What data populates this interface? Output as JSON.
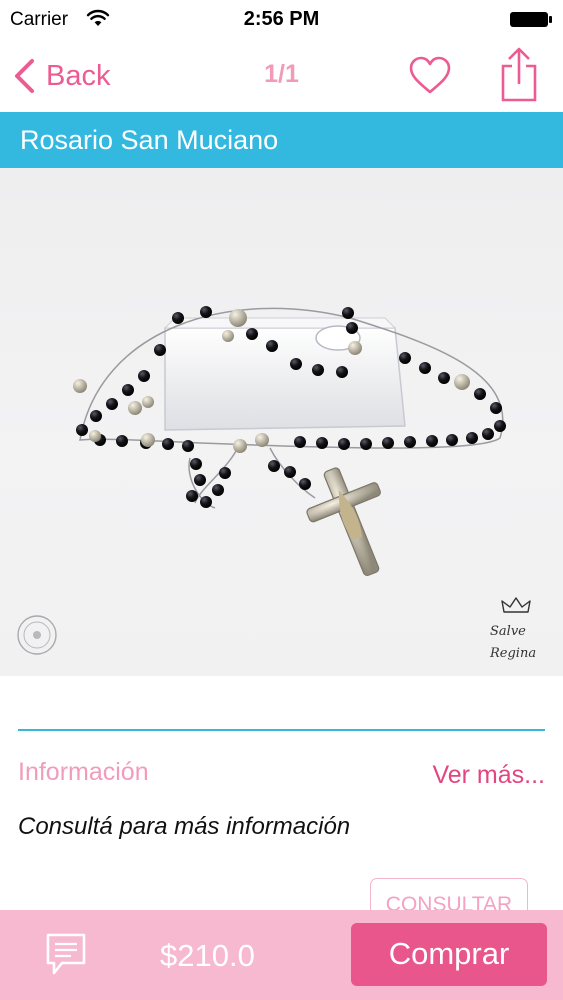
{
  "status_bar": {
    "carrier": "Carrier",
    "time": "2:56 PM",
    "icons": [
      "wifi-icon",
      "battery-icon"
    ]
  },
  "nav": {
    "back_label": "Back",
    "page_counter": "1/1",
    "icons": [
      "back-chevron-icon",
      "heart-icon",
      "share-icon"
    ]
  },
  "product": {
    "title": "Rosario San Muciano",
    "image_watermark": "Salve Regina"
  },
  "info": {
    "heading": "Información",
    "more_link": "Ver más...",
    "body": "Consultá para más información",
    "consult_button": "CONSULTAR"
  },
  "footer": {
    "price": "$210.0",
    "buy_button": "Comprar",
    "icons": [
      "chat-icon"
    ]
  },
  "colors": {
    "accent_pink": "#e8568c",
    "light_pink": "#f6b9cf",
    "title_bar_blue": "#33b8e0"
  }
}
